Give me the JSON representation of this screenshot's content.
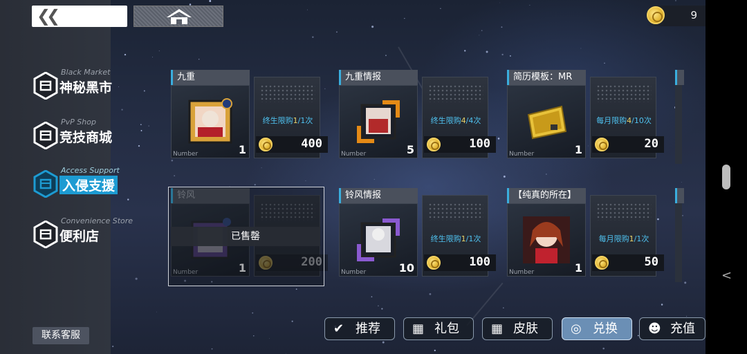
{
  "currency": {
    "amount": "9",
    "icon": "coin-icon"
  },
  "topbar": {
    "back_icon": "double-chevron-left-icon",
    "home_icon": "home-icon"
  },
  "nav": [
    {
      "en": "Black Market",
      "cn": "神秘黑市",
      "active": false
    },
    {
      "en": "PvP Shop",
      "cn": "竞技商城",
      "active": false
    },
    {
      "en": "Access Support",
      "cn": "入侵支援",
      "active": true
    },
    {
      "en": "Convenience Store",
      "cn": "便利店",
      "active": false
    }
  ],
  "items": [
    {
      "title": "九重",
      "qty": "1",
      "num_label": "Number",
      "limit_text": "终生限购",
      "limit_used": "1",
      "limit_total": "1次",
      "price": "400",
      "sold": false
    },
    {
      "title": "九重情报",
      "qty": "5",
      "num_label": "Number",
      "limit_text": "终生限购",
      "limit_used": "4",
      "limit_total": "4次",
      "price": "100",
      "sold": false
    },
    {
      "title": "简历模板：MR",
      "qty": "1",
      "num_label": "Number",
      "limit_text": "每月限购",
      "limit_used": "4",
      "limit_total": "10次",
      "price": "20",
      "sold": false
    },
    {
      "title": "铃风",
      "qty": "1",
      "num_label": "Number",
      "limit_text": "",
      "limit_used": "",
      "limit_total": "",
      "price": "200",
      "sold": true
    },
    {
      "title": "铃风情报",
      "qty": "10",
      "num_label": "Number",
      "limit_text": "终生限购",
      "limit_used": "1",
      "limit_total": "1次",
      "price": "100",
      "sold": false
    },
    {
      "title": "【纯真的所在】",
      "qty": "1",
      "num_label": "Number",
      "limit_text": "每月限购",
      "limit_used": "1",
      "limit_total": "1次",
      "price": "50",
      "sold": false
    }
  ],
  "sold_label": "已售罄",
  "edge_label": "Nu",
  "tabs": [
    {
      "label": "推荐",
      "icon": "recommend-icon",
      "active": false
    },
    {
      "label": "礼包",
      "icon": "gift-icon",
      "active": false
    },
    {
      "label": "皮肤",
      "icon": "gift-icon",
      "active": false
    },
    {
      "label": "兑换",
      "icon": "exchange-icon",
      "active": true
    },
    {
      "label": "充值",
      "icon": "people-icon",
      "active": false
    }
  ],
  "service_button": "联系客服",
  "colors": {
    "accent": "#1d9bd2",
    "limit": "#4fc2f0",
    "coin": "#e2b431",
    "active_tab": "#6b8fb5"
  }
}
